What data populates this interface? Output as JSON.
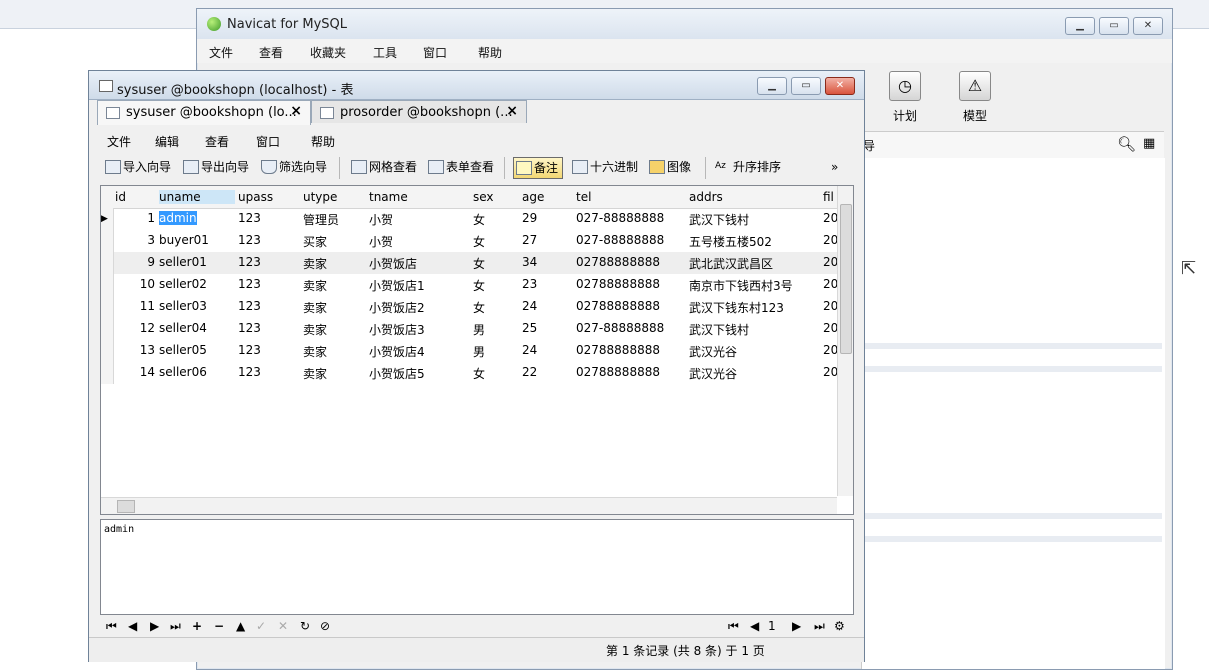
{
  "main_window": {
    "title": "Navicat for MySQL",
    "menu": [
      "文件",
      "查看",
      "收藏夹",
      "工具",
      "窗口",
      "帮助"
    ],
    "tools": [
      {
        "label": "计划",
        "icon": "calendar-clock-icon"
      },
      {
        "label": "模型",
        "icon": "model-icon"
      }
    ],
    "panel_header_fragment": "导"
  },
  "child_window": {
    "title": "sysuser @bookshopn (localhost) - 表",
    "tabs": [
      {
        "label": "sysuser @bookshopn (lo...",
        "active": true
      },
      {
        "label": "prosorder @bookshopn (...",
        "active": false
      }
    ],
    "menu": [
      "文件",
      "编辑",
      "查看",
      "窗口",
      "帮助"
    ],
    "toolbar": {
      "import": "导入向导",
      "export": "导出向导",
      "filter": "筛选向导",
      "grid_view": "网格查看",
      "form_view": "表单查看",
      "memo": "备注",
      "hex": "十六进制",
      "image": "图像",
      "sort_asc": "升序排序",
      "more": "»"
    },
    "grid": {
      "columns": [
        "id",
        "uname",
        "upass",
        "utype",
        "tname",
        "sex",
        "age",
        "tel",
        "addrs",
        "fil"
      ],
      "selected_column": "uname",
      "rows": [
        {
          "id": "1",
          "uname": "admin",
          "upass": "123",
          "utype": "管理员",
          "tname": "小贺",
          "sex": "女",
          "age": "29",
          "tel": "027-88888888",
          "addrs": "武汉下钱村",
          "fil": "20"
        },
        {
          "id": "3",
          "uname": "buyer01",
          "upass": "123",
          "utype": "买家",
          "tname": "小贺",
          "sex": "女",
          "age": "27",
          "tel": "027-88888888",
          "addrs": "五号楼五楼502",
          "fil": "20"
        },
        {
          "id": "9",
          "uname": "seller01",
          "upass": "123",
          "utype": "卖家",
          "tname": "小贺饭店",
          "sex": "女",
          "age": "34",
          "tel": "02788888888",
          "addrs": "武北武汉武昌区",
          "fil": "20"
        },
        {
          "id": "10",
          "uname": "seller02",
          "upass": "123",
          "utype": "卖家",
          "tname": "小贺饭店1",
          "sex": "女",
          "age": "23",
          "tel": "02788888888",
          "addrs": "南京市下钱西村3号",
          "fil": "20"
        },
        {
          "id": "11",
          "uname": "seller03",
          "upass": "123",
          "utype": "卖家",
          "tname": "小贺饭店2",
          "sex": "女",
          "age": "24",
          "tel": "02788888888",
          "addrs": "武汉下钱东村123",
          "fil": "20"
        },
        {
          "id": "12",
          "uname": "seller04",
          "upass": "123",
          "utype": "卖家",
          "tname": "小贺饭店3",
          "sex": "男",
          "age": "25",
          "tel": "027-88888888",
          "addrs": "武汉下钱村",
          "fil": "20"
        },
        {
          "id": "13",
          "uname": "seller05",
          "upass": "123",
          "utype": "卖家",
          "tname": "小贺饭店4",
          "sex": "男",
          "age": "24",
          "tel": "02788888888",
          "addrs": "武汉光谷",
          "fil": "20"
        },
        {
          "id": "14",
          "uname": "seller06",
          "upass": "123",
          "utype": "卖家",
          "tname": "小贺饭店5",
          "sex": "女",
          "age": "22",
          "tel": "02788888888",
          "addrs": "武汉光谷",
          "fil": "20"
        }
      ]
    },
    "memo_value": "admin",
    "nav": {
      "page": "1"
    },
    "status": "第 1 条记录 (共 8 条) 于 1 页"
  }
}
